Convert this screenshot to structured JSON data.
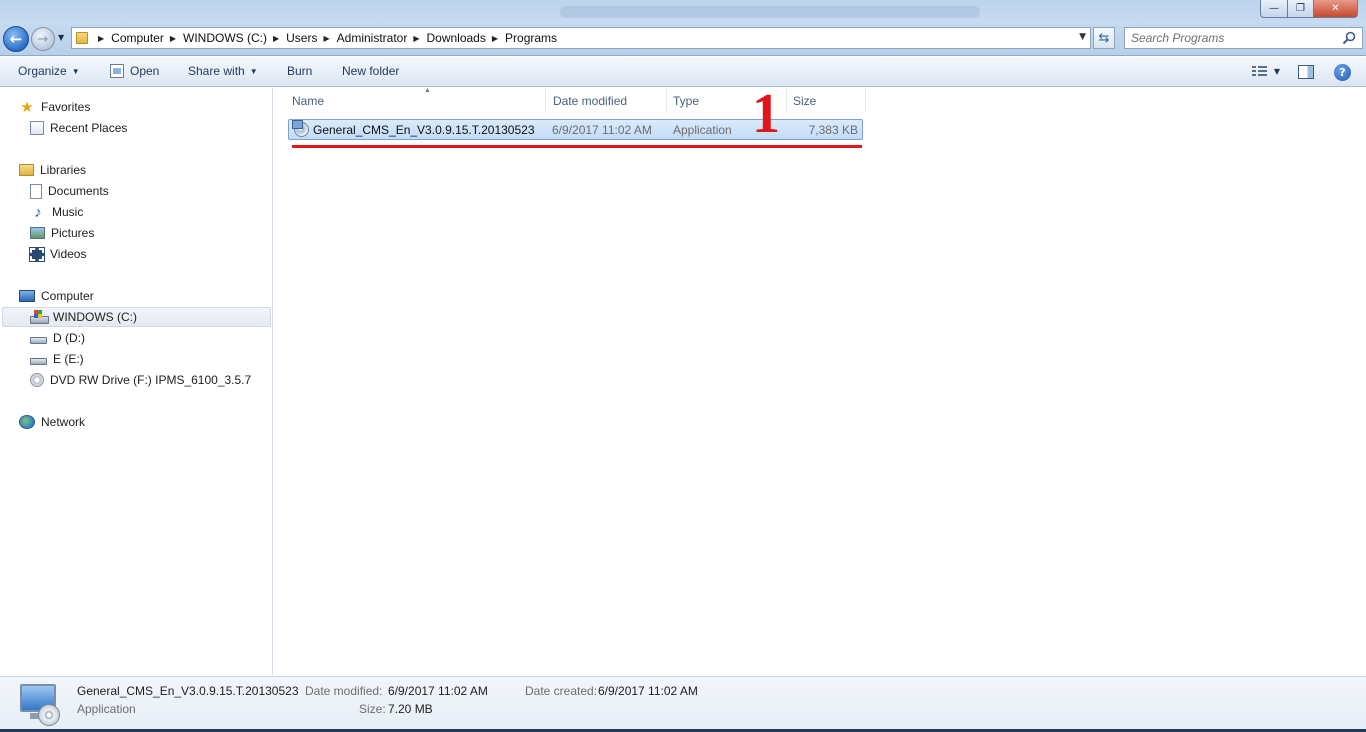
{
  "window": {
    "controls": {
      "minimize": "—",
      "maximize": "❐",
      "close": "✕"
    }
  },
  "address": {
    "breadcrumbs": [
      "Computer",
      "WINDOWS (C:)",
      "Users",
      "Administrator",
      "Downloads",
      "Programs"
    ]
  },
  "search": {
    "placeholder": "Search Programs"
  },
  "toolbar": {
    "organize": "Organize",
    "open": "Open",
    "share_with": "Share with",
    "burn": "Burn",
    "new_folder": "New folder"
  },
  "navpane": {
    "favorites": "Favorites",
    "recent_places": "Recent Places",
    "libraries": "Libraries",
    "documents": "Documents",
    "music": "Music",
    "pictures": "Pictures",
    "videos": "Videos",
    "computer": "Computer",
    "drive_c": "WINDOWS (C:)",
    "drive_d": "D (D:)",
    "drive_e": "E (E:)",
    "drive_f": "DVD RW Drive (F:) IPMS_6100_3.5.7",
    "network": "Network"
  },
  "columns": {
    "name": "Name",
    "date_modified": "Date modified",
    "type": "Type",
    "size": "Size"
  },
  "files": [
    {
      "name": "General_CMS_En_V3.0.9.15.T.20130523",
      "date_modified": "6/9/2017 11:02 AM",
      "type": "Application",
      "size": "7,383 KB"
    }
  ],
  "annotation": {
    "number": "1",
    "color": "#e1161a"
  },
  "details": {
    "name": "General_CMS_En_V3.0.9.15.T.20130523",
    "type": "Application",
    "date_modified_label": "Date modified:",
    "date_modified": "6/9/2017 11:02 AM",
    "size_label": "Size:",
    "size": "7.20 MB",
    "date_created_label": "Date created:",
    "date_created": "6/9/2017 11:02 AM"
  },
  "colors": {
    "selection": "#c1dcf8",
    "toolbar_text": "#1e395b",
    "header_text": "#4c607a"
  }
}
